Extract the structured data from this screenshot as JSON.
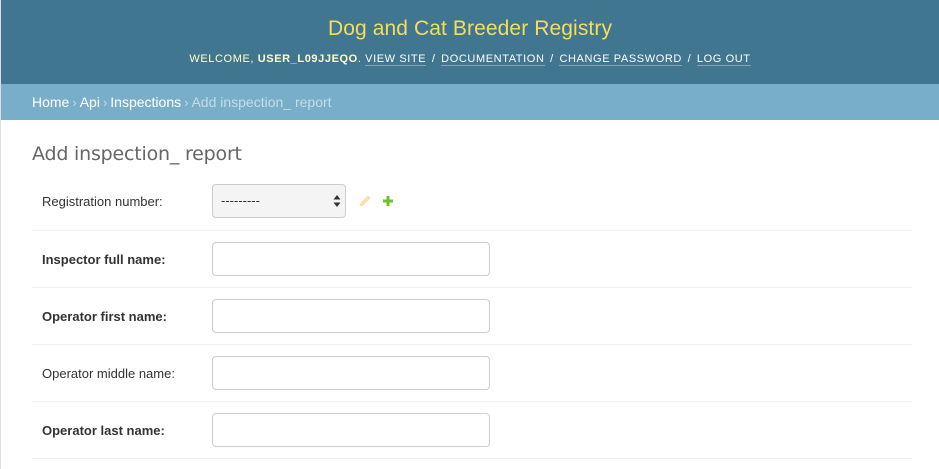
{
  "header": {
    "site_title": "Dog and Cat Breeder Registry",
    "welcome_text": "Welcome,",
    "username": "user_l09jjeqo",
    "links": {
      "view_site": "View site",
      "documentation": "Documentation",
      "change_password": "Change password",
      "log_out": "Log out"
    }
  },
  "breadcrumbs": [
    {
      "label": "Home"
    },
    {
      "label": "Api"
    },
    {
      "label": "Inspections"
    },
    {
      "label": "Add inspection_ report"
    }
  ],
  "page_title": "Add inspection_ report",
  "form": {
    "registration_number": {
      "label": "Registration number:",
      "selected": "---------",
      "edit_icon": "pencil-icon",
      "add_icon": "plus-icon"
    },
    "fields": [
      {
        "label": "Inspector full name:",
        "value": "",
        "required": true
      },
      {
        "label": "Operator first name:",
        "value": "",
        "required": true
      },
      {
        "label": "Operator middle name:",
        "value": "",
        "required": false
      },
      {
        "label": "Operator last name:",
        "value": "",
        "required": true
      }
    ]
  },
  "colors": {
    "header_bg": "#417690",
    "title_yellow": "#f5dd5d",
    "breadcrumb_bg": "#79aec8",
    "add_green": "#70bf2b",
    "edit_yellow": "#efb80b"
  }
}
